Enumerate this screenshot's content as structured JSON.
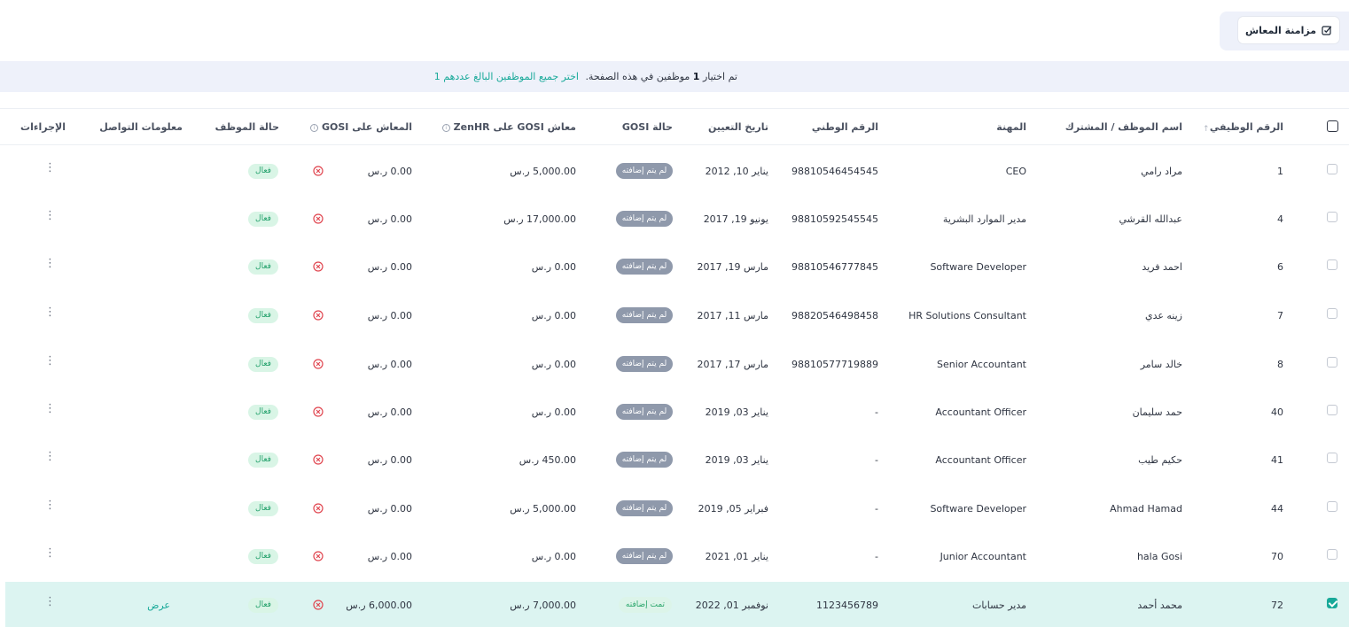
{
  "toolbar": {
    "sync_label": "مزامنة المعاش"
  },
  "banner": {
    "prefix": "تم اختيار",
    "count": "1",
    "suffix": "موظفين في هذه الصفحة.",
    "select_all_link": "اختر جميع الموظفين البالغ عددهم 1"
  },
  "columns": {
    "employee_id": "الرقم الوظيفي",
    "employee_name": "اسم الموظف / المشترك",
    "profession": "المهنة",
    "national_id": "الرقم الوطني",
    "hire_date": "تاريخ التعيين",
    "gosi_status": "حالة GOSI",
    "zenhr_salary": "معاش GOSI على ZenHR",
    "gosi_salary": "المعاش على GOSI",
    "employee_status": "حالة الموظف",
    "contact_info": "معلومات التواصل",
    "actions": "الإجراءات"
  },
  "colors": {
    "accent": "#18a999",
    "banner_bg": "#eef1fa",
    "selected_row": "#dcf4f1",
    "error": "#e0454f"
  },
  "rows": [
    {
      "id": "1",
      "name": "مراد رامي",
      "profession": "CEO",
      "national_id": "98810546454545",
      "hire_date": "يناير 10, 2012",
      "gosi_status": "لم يتم إضافته",
      "gosi_added": false,
      "zenhr_salary": "5,000.00 ر.س",
      "gosi_salary": "0.00 ر.س",
      "status": "فعال",
      "contact": "",
      "selected": false
    },
    {
      "id": "4",
      "name": "عبدالله القرشي",
      "profession": "مدير الموارد البشرية",
      "national_id": "98810592545545",
      "hire_date": "يونيو 19, 2017",
      "gosi_status": "لم يتم إضافته",
      "gosi_added": false,
      "zenhr_salary": "17,000.00 ر.س",
      "gosi_salary": "0.00 ر.س",
      "status": "فعال",
      "contact": "",
      "selected": false
    },
    {
      "id": "6",
      "name": "احمد فريد",
      "profession": "Software Developer",
      "national_id": "98810546777845",
      "hire_date": "مارس 19, 2017",
      "gosi_status": "لم يتم إضافته",
      "gosi_added": false,
      "zenhr_salary": "0.00 ر.س",
      "gosi_salary": "0.00 ر.س",
      "status": "فعال",
      "contact": "",
      "selected": false
    },
    {
      "id": "7",
      "name": "زينه عدي",
      "profession": "HR Solutions Consultant",
      "national_id": "98820546498458",
      "hire_date": "مارس 11, 2017",
      "gosi_status": "لم يتم إضافته",
      "gosi_added": false,
      "zenhr_salary": "0.00 ر.س",
      "gosi_salary": "0.00 ر.س",
      "status": "فعال",
      "contact": "",
      "selected": false
    },
    {
      "id": "8",
      "name": "خالد سامر",
      "profession": "Senior Accountant",
      "national_id": "98810577719889",
      "hire_date": "مارس 17, 2017",
      "gosi_status": "لم يتم إضافته",
      "gosi_added": false,
      "zenhr_salary": "0.00 ر.س",
      "gosi_salary": "0.00 ر.س",
      "status": "فعال",
      "contact": "",
      "selected": false
    },
    {
      "id": "40",
      "name": "حمد سليمان",
      "profession": "Accountant Officer",
      "national_id": "-",
      "hire_date": "يناير 03, 2019",
      "gosi_status": "لم يتم إضافته",
      "gosi_added": false,
      "zenhr_salary": "0.00 ر.س",
      "gosi_salary": "0.00 ر.س",
      "status": "فعال",
      "contact": "",
      "selected": false
    },
    {
      "id": "41",
      "name": "حكيم طيب",
      "profession": "Accountant Officer",
      "national_id": "-",
      "hire_date": "يناير 03, 2019",
      "gosi_status": "لم يتم إضافته",
      "gosi_added": false,
      "zenhr_salary": "450.00 ر.س",
      "gosi_salary": "0.00 ر.س",
      "status": "فعال",
      "contact": "",
      "selected": false
    },
    {
      "id": "44",
      "name": "Ahmad Hamad",
      "profession": "Software Developer",
      "national_id": "-",
      "hire_date": "فبراير 05, 2019",
      "gosi_status": "لم يتم إضافته",
      "gosi_added": false,
      "zenhr_salary": "5,000.00 ر.س",
      "gosi_salary": "0.00 ر.س",
      "status": "فعال",
      "contact": "",
      "selected": false
    },
    {
      "id": "70",
      "name": "hala Gosi",
      "profession": "Junior Accountant",
      "national_id": "-",
      "hire_date": "يناير 01, 2021",
      "gosi_status": "لم يتم إضافته",
      "gosi_added": false,
      "zenhr_salary": "0.00 ر.س",
      "gosi_salary": "0.00 ر.س",
      "status": "فعال",
      "contact": "",
      "selected": false
    },
    {
      "id": "72",
      "name": "محمد أحمد",
      "profession": "مدير حسابات",
      "national_id": "1123456789",
      "hire_date": "نوفمبر 01, 2022",
      "gosi_status": "تمت إضافته",
      "gosi_added": true,
      "zenhr_salary": "7,000.00 ر.س",
      "gosi_salary": "6,000.00 ر.س",
      "status": "فعال",
      "contact": "عرض",
      "selected": true
    }
  ]
}
